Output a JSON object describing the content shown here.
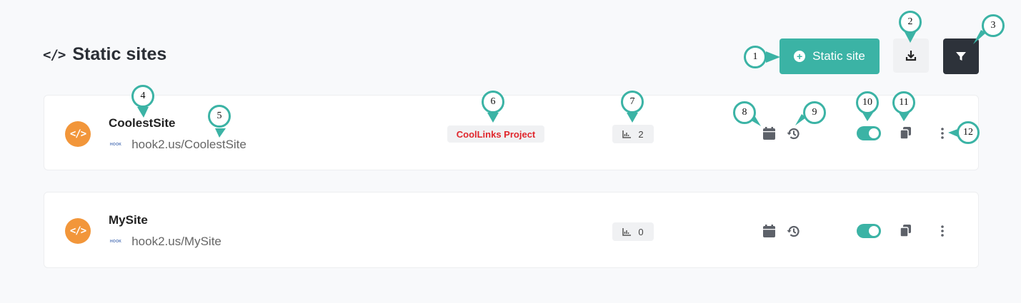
{
  "header": {
    "title": "Static sites",
    "icon": "code-icon"
  },
  "toolbar": {
    "add_label": "Static site",
    "download_icon": "download-icon",
    "filter_icon": "filter-icon"
  },
  "sites": [
    {
      "name": "CoolestSite",
      "url": "hook2.us/CoolestSite",
      "logo_text": "HOOK",
      "project": "CoolLinks Project",
      "stats": "2",
      "enabled": true
    },
    {
      "name": "MySite",
      "url": "hook2.us/MySite",
      "logo_text": "HOOK",
      "project": "",
      "stats": "0",
      "enabled": true
    }
  ],
  "callouts": [
    "1",
    "2",
    "3",
    "4",
    "5",
    "6",
    "7",
    "8",
    "9",
    "10",
    "11",
    "12"
  ],
  "colors": {
    "accent": "#3bb3a5",
    "site_icon": "#f2963a",
    "project_tag_text": "#e0262c",
    "filter_bg": "#2d323a"
  }
}
